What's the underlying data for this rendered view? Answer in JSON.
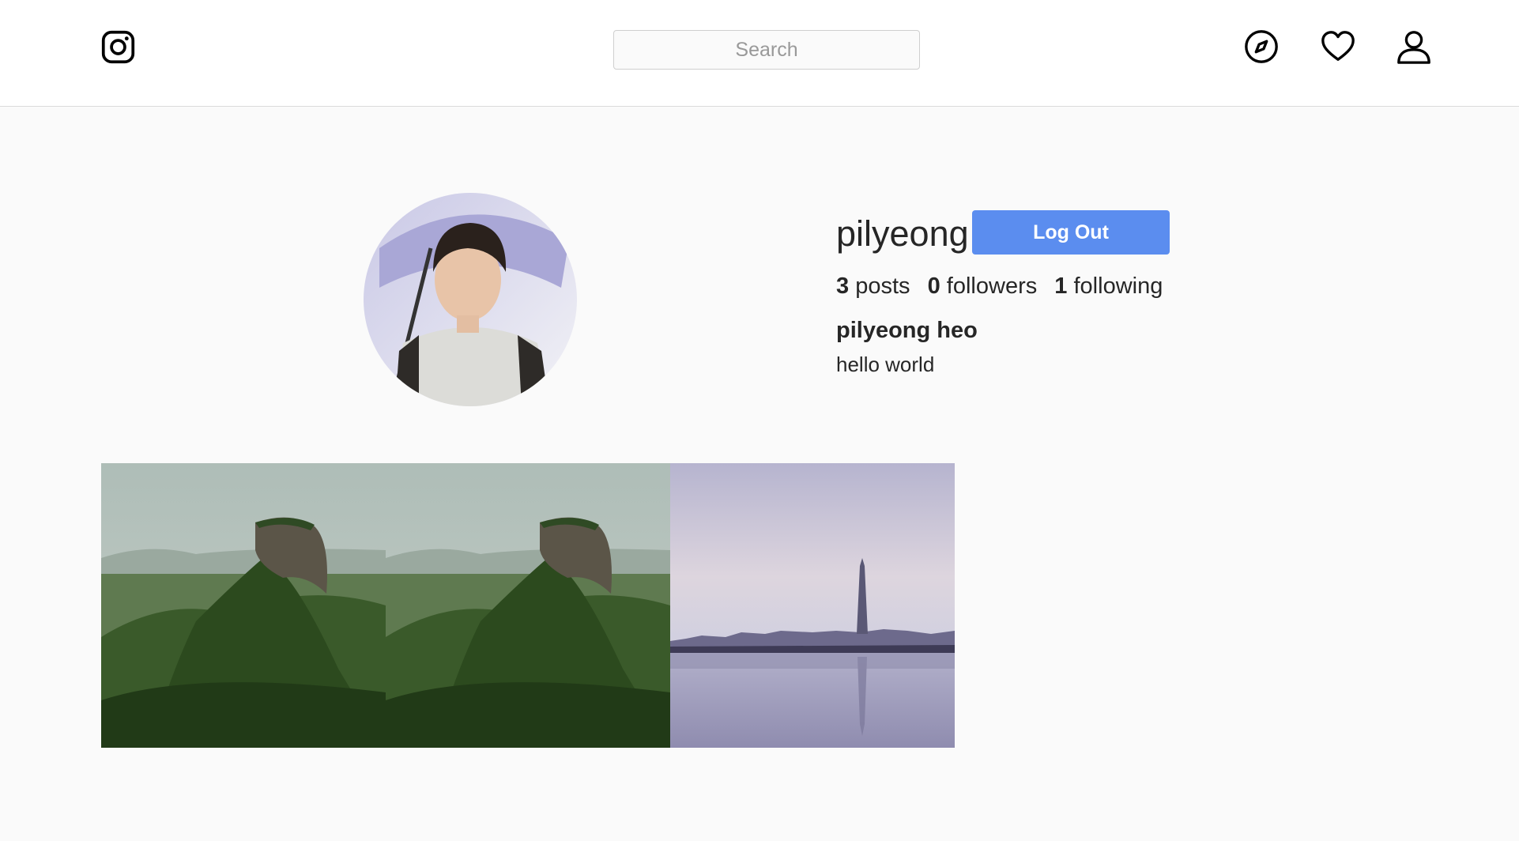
{
  "header": {
    "logo_icon": "instagram-icon",
    "search": {
      "placeholder": "Search",
      "value": ""
    },
    "nav_icons": [
      "compass-icon",
      "heart-icon",
      "user-icon"
    ]
  },
  "profile": {
    "username": "pilyeong",
    "logout_label": "Log Out",
    "stats": {
      "posts_count": "3",
      "posts_label": "posts",
      "followers_count": "0",
      "followers_label": "followers",
      "following_count": "1",
      "following_label": "following"
    },
    "full_name": "pilyeong heo",
    "bio": "hello world"
  },
  "posts": [
    {
      "image": "rock-fortress-jungle-photo"
    },
    {
      "image": "rock-fortress-jungle-photo"
    },
    {
      "image": "city-skyline-lake-reflection-photo"
    }
  ],
  "colors": {
    "accent_button": "#5b8def",
    "background": "#fafafa",
    "header_bg": "#ffffff",
    "border": "#dbdbdb"
  }
}
